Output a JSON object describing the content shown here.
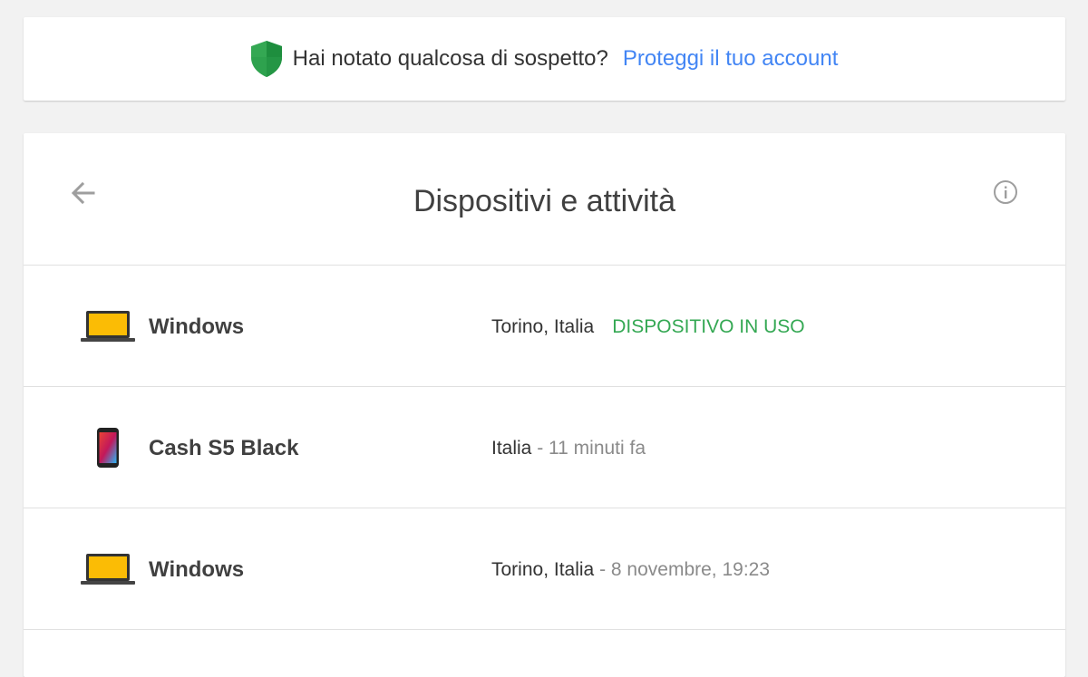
{
  "banner": {
    "question": "Hai notato qualcosa di sospetto?",
    "link": "Proteggi il tuo account",
    "shield_color": "#34a853",
    "link_color": "#4285f4"
  },
  "card": {
    "title": "Dispositivi e attività",
    "back_icon": "arrow-back-icon",
    "info_icon": "info-icon"
  },
  "devices": [
    {
      "name": "Windows",
      "icon": "laptop-icon",
      "location": "Torino, Italia",
      "separator": "",
      "time": "",
      "status": "DISPOSITIVO IN USO"
    },
    {
      "name": "Cash S5 Black",
      "icon": "phone-icon",
      "location": "Italia",
      "separator": " - ",
      "time": "11 minuti fa",
      "status": ""
    },
    {
      "name": "Windows",
      "icon": "laptop-icon",
      "location": "Torino, Italia",
      "separator": " - ",
      "time": "8 novembre, 19:23",
      "status": ""
    }
  ]
}
